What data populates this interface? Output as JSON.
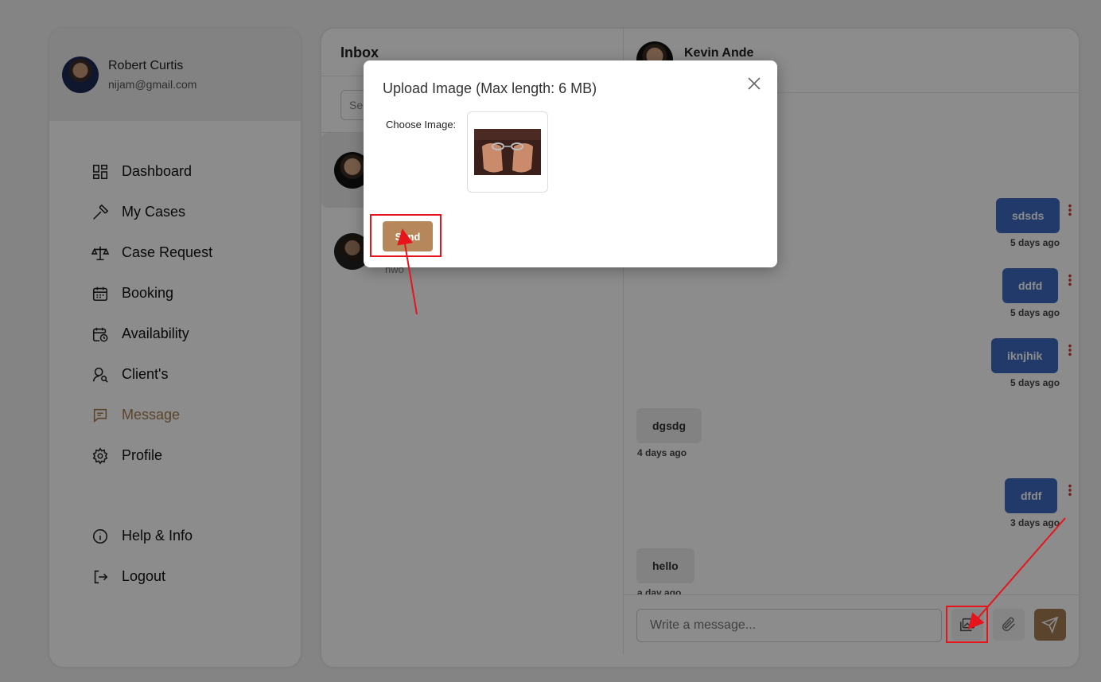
{
  "user": {
    "name": "Robert Curtis",
    "email": "nijam@gmail.com"
  },
  "nav": {
    "items": [
      {
        "label": "Dashboard",
        "icon": "dashboard-icon"
      },
      {
        "label": "My Cases",
        "icon": "hammer-icon"
      },
      {
        "label": "Case Request",
        "icon": "scales-icon"
      },
      {
        "label": "Booking",
        "icon": "calendar-icon"
      },
      {
        "label": "Availability",
        "icon": "calendar-clock-icon"
      },
      {
        "label": "Client's",
        "icon": "user-search-icon"
      },
      {
        "label": "Message",
        "icon": "message-icon",
        "active": true
      },
      {
        "label": "Profile",
        "icon": "gear-icon"
      }
    ],
    "bottom": [
      {
        "label": "Help & Info",
        "icon": "info-icon"
      },
      {
        "label": "Logout",
        "icon": "logout-icon"
      }
    ],
    "active_color": "#a67c52"
  },
  "inbox": {
    "title": "Inbox",
    "search_placeholder": "Se",
    "contact2_sub": "nwo"
  },
  "chat": {
    "contact_name": "Kevin Ande",
    "messages": [
      {
        "dir": "out",
        "text": "sdsds",
        "time": "5 days ago"
      },
      {
        "dir": "out",
        "text": "ddfd",
        "time": "5 days ago"
      },
      {
        "dir": "out",
        "text": "iknjhik",
        "time": "5 days ago"
      },
      {
        "dir": "in",
        "text": "dgsdg",
        "time": "4 days ago"
      },
      {
        "dir": "out",
        "text": "dfdf",
        "time": "3 days ago"
      },
      {
        "dir": "in",
        "text": "hello",
        "time": "a day ago"
      }
    ],
    "input_placeholder": "Write a message...",
    "outgoing_color": "#3c6bc0",
    "send_color": "#a67c52"
  },
  "modal": {
    "title": "Upload Image (Max length: 6 MB)",
    "choose_label": "Choose Image:",
    "send_label": "Send"
  },
  "annotation_color": "#e8141c"
}
